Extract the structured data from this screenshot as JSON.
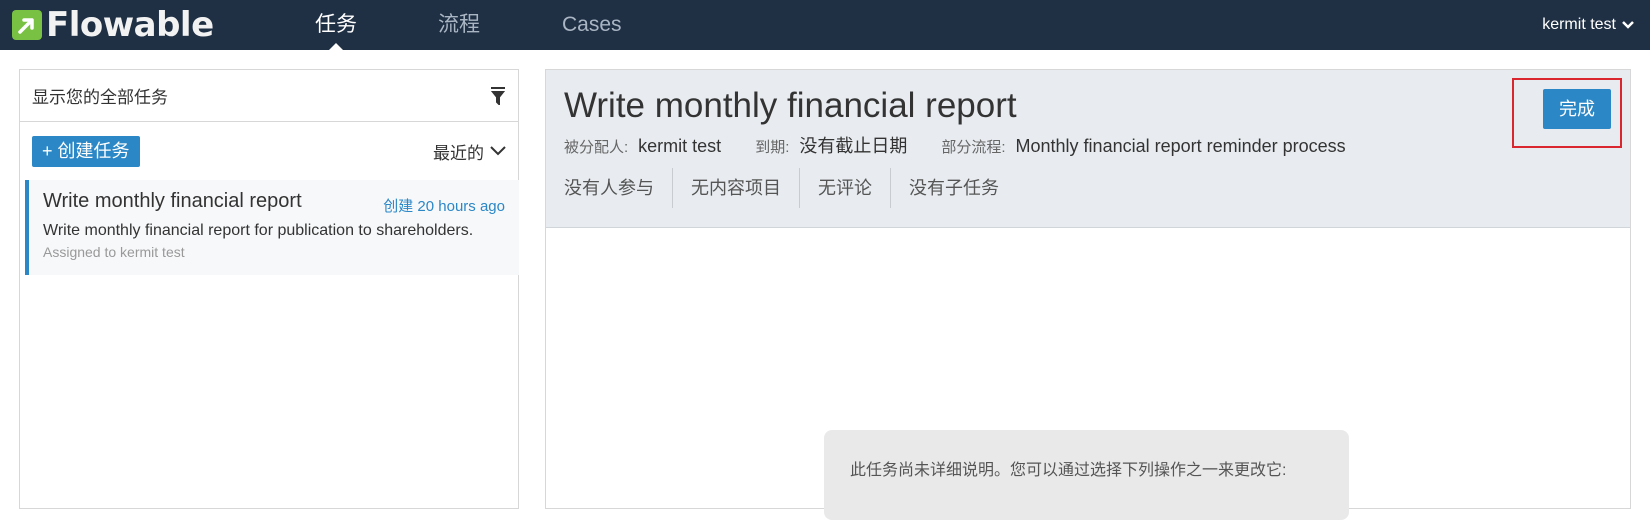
{
  "app": {
    "brand": "Flowable"
  },
  "nav": {
    "tabs": [
      {
        "label": "任务",
        "active": true
      },
      {
        "label": "流程",
        "active": false
      },
      {
        "label": "Cases",
        "active": false
      }
    ],
    "user": "kermit test",
    "user_icon": "chevron-down-icon"
  },
  "sidebar": {
    "filter_label": "显示您的全部任务",
    "filter_icon": "filter-icon",
    "create_button": "+ 创建任务",
    "sort_label": "最近的",
    "tasks": [
      {
        "title": "Write monthly financial report",
        "created": "创建 20 hours ago",
        "description": "Write monthly financial report for publication to shareholders.",
        "assigned": "Assigned to kermit test"
      }
    ]
  },
  "detail": {
    "title": "Write monthly financial report",
    "assignee_label": "被分配人:",
    "assignee_value": "kermit test",
    "due_label": "到期:",
    "due_value": "没有截止日期",
    "process_label": "部分流程:",
    "process_value": "Monthly financial report reminder process",
    "tabs": [
      "没有人参与",
      "无内容项目",
      "无评论",
      "没有子任务"
    ],
    "complete_button": "完成",
    "empty_message": "此任务尚未详细说明。您可以通过选择下列操作之一来更改它:"
  },
  "colors": {
    "navbar": "#1f2f44",
    "accent": "#2b87c6",
    "highlight": "#d9262f",
    "logo_green": "#79c142"
  }
}
